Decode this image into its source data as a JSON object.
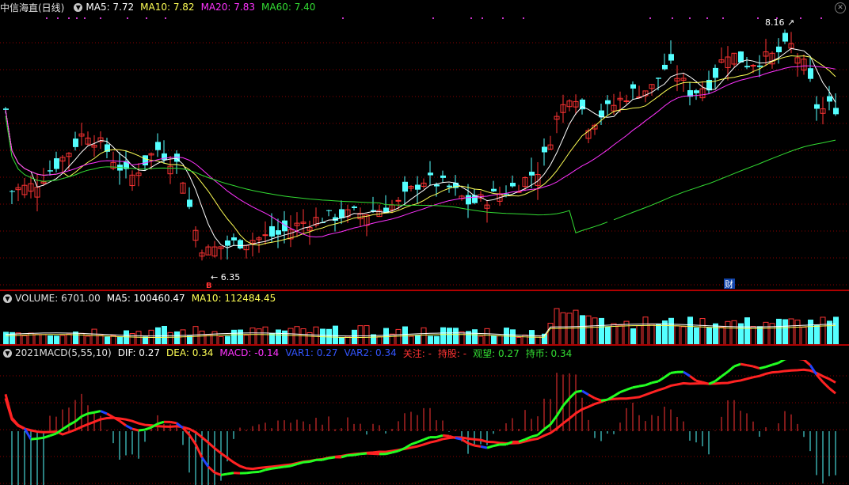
{
  "main": {
    "title": "中信海直(日线)",
    "ma5": "MA5: 7.72",
    "ma10": "MA10: 7.82",
    "ma20": "MA20: 7.83",
    "ma60": "MA60: 7.40",
    "high_label": "8.16",
    "low_label": "6.35",
    "buy_signal": "B",
    "fin_marker": "财"
  },
  "volume": {
    "label": "VOLUME: 6701.00",
    "ma5": "MA5: 100460.47",
    "ma10": "MA10: 112484.45"
  },
  "macd": {
    "title": "2021MACD(5,55,10)",
    "dif": "DIF: 0.27",
    "dea": "DEA: 0.34",
    "macd": "MACD: -0.14",
    "var1": "VAR1: 0.27",
    "var2": "VAR2: 0.34",
    "guanzhu": "关注: -",
    "chigu": "持股: -",
    "guanwang": "观望: 0.27",
    "chibi": "持币: 0.34"
  },
  "colors": {
    "up": "#ff3333",
    "down": "#54ffff",
    "ma5": "#ffffff",
    "ma10": "#ffff55",
    "ma20": "#ff33ff",
    "ma60": "#33dd33",
    "grid": "#8b0000"
  },
  "chart_data": {
    "type": "candlestick",
    "high": 8.16,
    "low": 6.35,
    "last_close_approx": 7.62
  }
}
